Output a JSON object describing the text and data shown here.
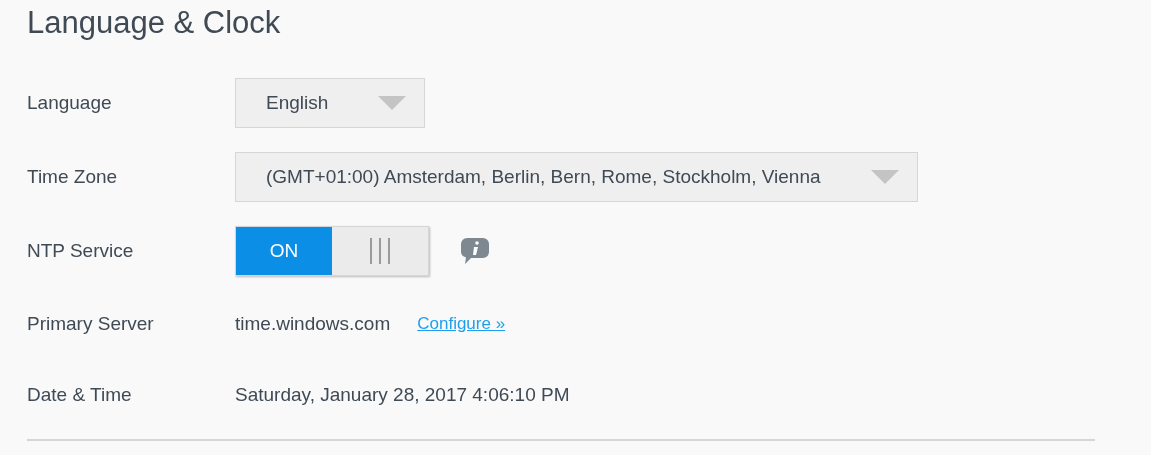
{
  "title": "Language & Clock",
  "rows": [
    {
      "kind": "select",
      "label": "Language",
      "value": "English"
    },
    {
      "kind": "select",
      "label": "Time Zone",
      "value": "(GMT+01:00) Amsterdam, Berlin, Bern, Rome, Stockholm, Vienna"
    },
    {
      "kind": "toggle",
      "label": "NTP Service",
      "toggle_text": "ON",
      "on": true
    },
    {
      "kind": "server",
      "label": "Primary Server",
      "value": "time.windows.com",
      "link": "Configure »"
    },
    {
      "kind": "text",
      "label": "Date & Time",
      "value": "Saturday, January 28, 2017 4:06:10 PM"
    }
  ]
}
